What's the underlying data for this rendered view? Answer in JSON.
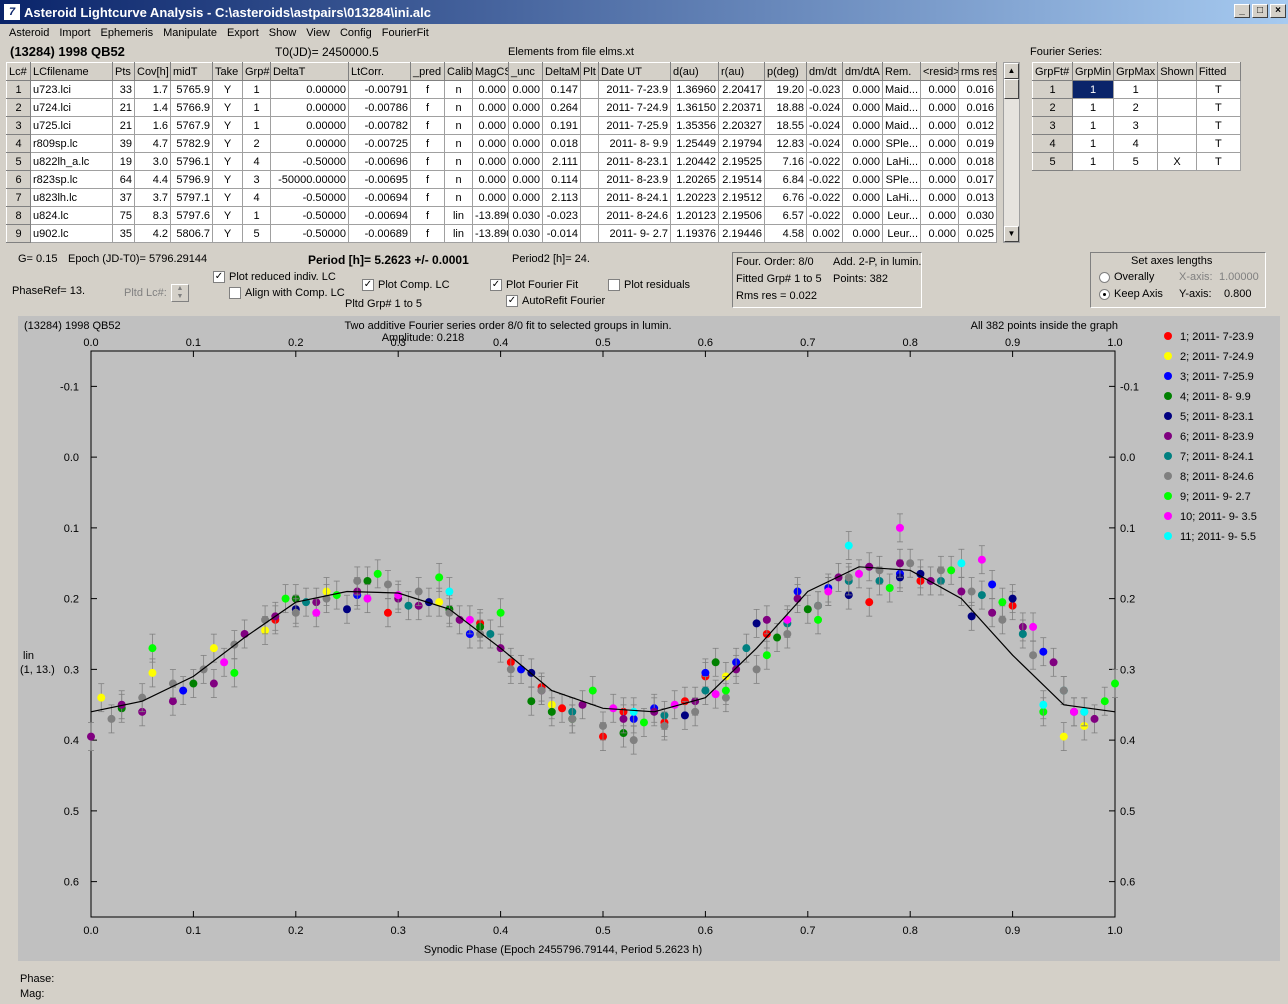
{
  "window": {
    "title": "Asteroid Lightcurve Analysis - C:\\asteroids\\astpairs\\013284\\ini.alc",
    "icon": "app-logo-icon",
    "buttons": [
      "minimize",
      "maximize",
      "close"
    ]
  },
  "menu": [
    "Asteroid",
    "Import",
    "Ephemeris",
    "Manipulate",
    "Export",
    "Show",
    "View",
    "Config",
    "FourierFit"
  ],
  "header": {
    "asteroid": "(13284) 1998 QB52",
    "t0": "T0(JD)= 2450000.5",
    "elements": "Elements from file elms.xt",
    "fourier_label": "Fourier Series:"
  },
  "lc_table": {
    "columns": [
      "Lc#",
      "LCfilename",
      "Pts",
      "Cov[h]",
      "midT",
      "Take",
      "Grp#",
      "DeltaT",
      "LtCorr.",
      "_pred",
      "Calib.",
      "MagCS",
      "_unc",
      "DeltaM",
      "Plt",
      "Date UT",
      "d(au)",
      "r(au)",
      "p(deg)",
      "dm/dt",
      "dm/dtA",
      "Rem.",
      "<resid>",
      "rms res"
    ],
    "rows": [
      [
        "1",
        "u723.lci",
        "33",
        "1.7",
        "5765.9",
        "Y",
        "1",
        "0.00000",
        "-0.00791",
        "f",
        "n",
        "0.000",
        "0.000",
        "0.147",
        "",
        "2011- 7-23.9",
        "1.36960",
        "2.20417",
        "19.20",
        "-0.023",
        "0.000",
        "Maid...",
        "0.000",
        "0.016"
      ],
      [
        "2",
        "u724.lci",
        "21",
        "1.4",
        "5766.9",
        "Y",
        "1",
        "0.00000",
        "-0.00786",
        "f",
        "n",
        "0.000",
        "0.000",
        "0.264",
        "",
        "2011- 7-24.9",
        "1.36150",
        "2.20371",
        "18.88",
        "-0.024",
        "0.000",
        "Maid...",
        "0.000",
        "0.016"
      ],
      [
        "3",
        "u725.lci",
        "21",
        "1.6",
        "5767.9",
        "Y",
        "1",
        "0.00000",
        "-0.00782",
        "f",
        "n",
        "0.000",
        "0.000",
        "0.191",
        "",
        "2011- 7-25.9",
        "1.35356",
        "2.20327",
        "18.55",
        "-0.024",
        "0.000",
        "Maid...",
        "0.000",
        "0.012"
      ],
      [
        "4",
        "r809sp.lc",
        "39",
        "4.7",
        "5782.9",
        "Y",
        "2",
        "0.00000",
        "-0.00725",
        "f",
        "n",
        "0.000",
        "0.000",
        "0.018",
        "",
        "2011- 8- 9.9",
        "1.25449",
        "2.19794",
        "12.83",
        "-0.024",
        "0.000",
        "SPle...",
        "0.000",
        "0.019"
      ],
      [
        "5",
        "u822lh_a.lc",
        "19",
        "3.0",
        "5796.1",
        "Y",
        "4",
        "-0.50000",
        "-0.00696",
        "f",
        "n",
        "0.000",
        "0.000",
        "2.111",
        "",
        "2011- 8-23.1",
        "1.20442",
        "2.19525",
        "7.16",
        "-0.022",
        "0.000",
        "LaHi...",
        "0.000",
        "0.018"
      ],
      [
        "6",
        "r823sp.lc",
        "64",
        "4.4",
        "5796.9",
        "Y",
        "3",
        "-50000.00000",
        "-0.00695",
        "f",
        "n",
        "0.000",
        "0.000",
        "0.114",
        "",
        "2011- 8-23.9",
        "1.20265",
        "2.19514",
        "6.84",
        "-0.022",
        "0.000",
        "SPle...",
        "0.000",
        "0.017"
      ],
      [
        "7",
        "u823lh.lc",
        "37",
        "3.7",
        "5797.1",
        "Y",
        "4",
        "-0.50000",
        "-0.00694",
        "f",
        "n",
        "0.000",
        "0.000",
        "2.113",
        "",
        "2011- 8-24.1",
        "1.20223",
        "2.19512",
        "6.76",
        "-0.022",
        "0.000",
        "LaHi...",
        "0.000",
        "0.013"
      ],
      [
        "8",
        "u824.lc",
        "75",
        "8.3",
        "5797.6",
        "Y",
        "1",
        "-0.50000",
        "-0.00694",
        "f",
        "lin",
        "-13.890",
        "0.030",
        "-0.023",
        "",
        "2011- 8-24.6",
        "1.20123",
        "2.19506",
        "6.57",
        "-0.022",
        "0.000",
        "Leur...",
        "0.000",
        "0.030"
      ],
      [
        "9",
        "u902.lc",
        "35",
        "4.2",
        "5806.7",
        "Y",
        "5",
        "-0.50000",
        "-0.00689",
        "f",
        "lin",
        "-13.890",
        "0.030",
        "-0.014",
        "",
        "2011- 9- 2.7",
        "1.19376",
        "2.19446",
        "4.58",
        "0.002",
        "0.000",
        "Leur...",
        "0.000",
        "0.025"
      ]
    ]
  },
  "fourier_table": {
    "columns": [
      "GrpFt#",
      "GrpMin",
      "GrpMax",
      "Shown",
      "Fitted"
    ],
    "rows": [
      [
        "1",
        "1",
        "1",
        "",
        "T"
      ],
      [
        "2",
        "1",
        "2",
        "",
        "T"
      ],
      [
        "3",
        "1",
        "3",
        "",
        "T"
      ],
      [
        "4",
        "1",
        "4",
        "",
        "T"
      ],
      [
        "5",
        "1",
        "5",
        "X",
        "T"
      ]
    ]
  },
  "controls": {
    "g": "G= 0.15",
    "epoch": "Epoch (JD-T0)= 5796.29144",
    "period": "Period [h]= 5.2623 +/- 0.0001",
    "period2": "Period2 [h]= 24.",
    "phaseref": "PhaseRef= 13.",
    "pltd_lc": "Pltd Lc#:",
    "pltd_grp": "Pltd Grp#  1   to   5",
    "cb_reduced": "Plot reduced indiv. LC",
    "cb_align": "Align with Comp. LC",
    "cb_comp": "Plot Comp. LC",
    "cb_fourier": "Plot Fourier Fit",
    "cb_refit": "AutoRefit Fourier",
    "cb_resid": "Plot residuals"
  },
  "fourier_info": {
    "order": "Four. Order:  8/0",
    "add": "Add. 2-P, in lumin.",
    "fitted": "Fitted Grp# 1 to 5",
    "points": "Points: 382",
    "rms": "Rms res     = 0.022"
  },
  "axes_box": {
    "title": "Set axes lengths",
    "overally": "Overally",
    "keep": "Keep Axis",
    "xaxis": "X-axis:",
    "xval": "1.00000",
    "yaxis": "Y-axis:",
    "yval": "0.800"
  },
  "status": {
    "phase": "Phase:",
    "mag": "Mag:"
  },
  "chart_data": {
    "type": "scatter",
    "name_label": "(13284) 1998 QB52",
    "title": "Two additive Fourier series order 8/0 fit to selected groups in lumin.",
    "subtitle": "Amplitude: 0.218",
    "note": "All 382 points inside the graph",
    "xlabel": "Synodic Phase (Epoch 2455796.79144, Period 5.2623 h)",
    "ylabel": "lin",
    "ylabel2": "(1, 13.)",
    "xlim": [
      0,
      1
    ],
    "ylim": [
      -0.15,
      0.65
    ],
    "y_inverted": true,
    "xticks": [
      "0.0",
      "0.1",
      "0.2",
      "0.3",
      "0.4",
      "0.5",
      "0.6",
      "0.7",
      "0.8",
      "0.9",
      "1.0"
    ],
    "yticks": [
      "-0.1",
      "0.0",
      "0.1",
      "0.2",
      "0.3",
      "0.4",
      "0.5",
      "0.6"
    ],
    "ytick_values": [
      -0.1,
      0,
      0.1,
      0.2,
      0.3,
      0.4,
      0.5,
      0.6
    ],
    "fit_curve": {
      "x": [
        0,
        0.05,
        0.1,
        0.15,
        0.2,
        0.25,
        0.3,
        0.35,
        0.4,
        0.45,
        0.5,
        0.55,
        0.6,
        0.65,
        0.7,
        0.75,
        0.8,
        0.85,
        0.9,
        0.95,
        1.0
      ],
      "y": [
        0.36,
        0.345,
        0.31,
        0.255,
        0.205,
        0.19,
        0.192,
        0.215,
        0.27,
        0.33,
        0.355,
        0.36,
        0.34,
        0.27,
        0.19,
        0.155,
        0.16,
        0.2,
        0.28,
        0.35,
        0.36
      ]
    },
    "series": [
      {
        "name": "1; 2011- 7-23.9",
        "color": "#ff0000",
        "x": [
          0.18,
          0.29,
          0.38,
          0.41,
          0.44,
          0.46,
          0.5,
          0.52,
          0.56,
          0.58,
          0.6,
          0.66,
          0.76,
          0.81,
          0.9
        ],
        "y": [
          0.23,
          0.22,
          0.235,
          0.29,
          0.325,
          0.355,
          0.395,
          0.36,
          0.375,
          0.345,
          0.31,
          0.25,
          0.205,
          0.175,
          0.21
        ]
      },
      {
        "name": "2; 2011- 7-24.9",
        "color": "#ffff00",
        "x": [
          0.01,
          0.06,
          0.12,
          0.17,
          0.23,
          0.34,
          0.45,
          0.62,
          0.72,
          0.95,
          0.97
        ],
        "y": [
          0.34,
          0.305,
          0.27,
          0.245,
          0.19,
          0.205,
          0.35,
          0.31,
          0.19,
          0.395,
          0.38
        ]
      },
      {
        "name": "3; 2011- 7-25.9",
        "color": "#0000ff",
        "x": [
          0.09,
          0.26,
          0.37,
          0.42,
          0.53,
          0.55,
          0.6,
          0.63,
          0.69,
          0.72,
          0.79,
          0.88,
          0.93
        ],
        "y": [
          0.33,
          0.195,
          0.25,
          0.3,
          0.37,
          0.355,
          0.305,
          0.29,
          0.19,
          0.185,
          0.165,
          0.18,
          0.275
        ]
      },
      {
        "name": "4; 2011- 8- 9.9",
        "color": "#008000",
        "x": [
          0.03,
          0.1,
          0.2,
          0.27,
          0.35,
          0.38,
          0.43,
          0.45,
          0.47,
          0.52,
          0.61,
          0.67,
          0.7
        ],
        "y": [
          0.355,
          0.32,
          0.2,
          0.175,
          0.215,
          0.24,
          0.345,
          0.36,
          0.37,
          0.39,
          0.29,
          0.255,
          0.215
        ]
      },
      {
        "name": "5; 2011- 8-23.1",
        "color": "#000080",
        "x": [
          0.2,
          0.25,
          0.33,
          0.43,
          0.58,
          0.65,
          0.74,
          0.79,
          0.81,
          0.86,
          0.9
        ],
        "y": [
          0.215,
          0.215,
          0.205,
          0.305,
          0.365,
          0.235,
          0.195,
          0.17,
          0.165,
          0.225,
          0.2
        ]
      },
      {
        "name": "6; 2011- 8-23.9",
        "color": "#800080",
        "x": [
          0,
          0.03,
          0.05,
          0.08,
          0.12,
          0.15,
          0.18,
          0.22,
          0.26,
          0.3,
          0.32,
          0.36,
          0.4,
          0.44,
          0.48,
          0.52,
          0.55,
          0.59,
          0.63,
          0.66,
          0.69,
          0.73,
          0.76,
          0.79,
          0.82,
          0.85,
          0.88,
          0.91,
          0.94,
          0.96,
          0.98
        ],
        "y": [
          0.395,
          0.35,
          0.36,
          0.345,
          0.32,
          0.25,
          0.225,
          0.205,
          0.19,
          0.2,
          0.21,
          0.23,
          0.27,
          0.33,
          0.35,
          0.37,
          0.36,
          0.345,
          0.3,
          0.23,
          0.2,
          0.17,
          0.155,
          0.15,
          0.175,
          0.19,
          0.22,
          0.24,
          0.29,
          0.36,
          0.37
        ]
      },
      {
        "name": "7; 2011- 8-24.1",
        "color": "#008080",
        "x": [
          0.21,
          0.31,
          0.39,
          0.47,
          0.56,
          0.6,
          0.64,
          0.68,
          0.71,
          0.74,
          0.77,
          0.83,
          0.87,
          0.91,
          0.95
        ],
        "y": [
          0.205,
          0.21,
          0.25,
          0.36,
          0.365,
          0.33,
          0.27,
          0.235,
          0.21,
          0.175,
          0.175,
          0.175,
          0.195,
          0.25,
          0.33
        ]
      },
      {
        "name": "8; 2011- 8-24.6",
        "color": "#808080",
        "x": [
          0.02,
          0.05,
          0.08,
          0.11,
          0.14,
          0.17,
          0.2,
          0.23,
          0.26,
          0.29,
          0.32,
          0.35,
          0.38,
          0.41,
          0.44,
          0.47,
          0.5,
          0.53,
          0.56,
          0.59,
          0.62,
          0.65,
          0.68,
          0.71,
          0.74,
          0.77,
          0.8,
          0.83,
          0.86,
          0.89,
          0.92,
          0.95,
          0.97
        ],
        "y": [
          0.37,
          0.34,
          0.32,
          0.3,
          0.265,
          0.23,
          0.22,
          0.2,
          0.175,
          0.18,
          0.19,
          0.22,
          0.25,
          0.3,
          0.33,
          0.37,
          0.38,
          0.4,
          0.38,
          0.36,
          0.34,
          0.3,
          0.25,
          0.21,
          0.17,
          0.16,
          0.15,
          0.16,
          0.19,
          0.23,
          0.28,
          0.33,
          0.36
        ]
      },
      {
        "name": "9; 2011- 9- 2.7",
        "color": "#00ff00",
        "x": [
          0.06,
          0.14,
          0.19,
          0.24,
          0.28,
          0.34,
          0.4,
          0.49,
          0.54,
          0.62,
          0.66,
          0.71,
          0.78,
          0.84,
          0.89,
          0.93,
          0.99,
          1.0
        ],
        "y": [
          0.27,
          0.305,
          0.2,
          0.195,
          0.165,
          0.17,
          0.22,
          0.33,
          0.375,
          0.33,
          0.28,
          0.23,
          0.185,
          0.16,
          0.205,
          0.36,
          0.345,
          0.32
        ]
      },
      {
        "name": "10; 2011- 9- 3.5",
        "color": "#ff00ff",
        "x": [
          0.13,
          0.22,
          0.27,
          0.3,
          0.37,
          0.51,
          0.57,
          0.61,
          0.68,
          0.72,
          0.75,
          0.79,
          0.87,
          0.92,
          0.96
        ],
        "y": [
          0.29,
          0.22,
          0.2,
          0.195,
          0.23,
          0.355,
          0.35,
          0.335,
          0.23,
          0.19,
          0.165,
          0.1,
          0.145,
          0.24,
          0.36
        ]
      },
      {
        "name": "11; 2011- 9- 5.5",
        "color": "#00ffff",
        "x": [
          0.35,
          0.53,
          0.74,
          0.85,
          0.93,
          0.97
        ],
        "y": [
          0.19,
          0.36,
          0.125,
          0.15,
          0.35,
          0.36
        ]
      }
    ]
  }
}
